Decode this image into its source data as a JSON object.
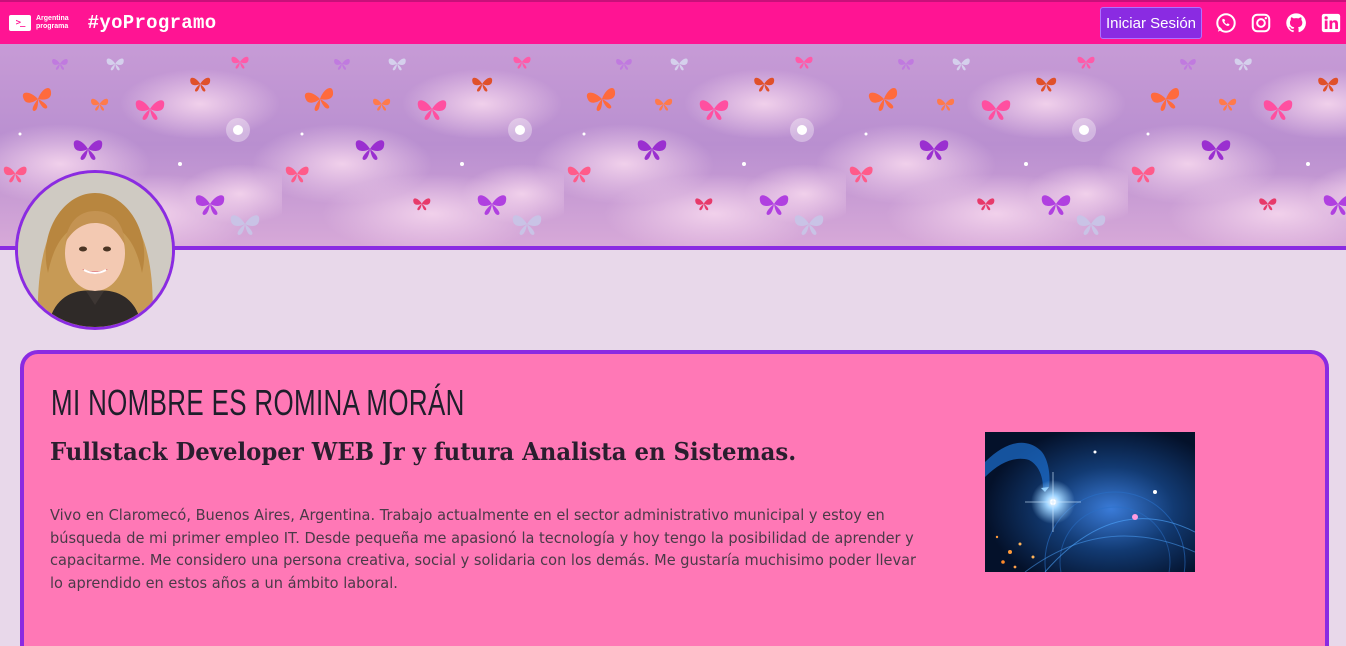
{
  "navbar": {
    "logo_mark": ">_",
    "logo_line1": "Argentina",
    "logo_line2": "programa",
    "hashtag": "#yoProgramo",
    "login_label": "Iniciar Sesión",
    "social_icons": [
      "whatsapp-icon",
      "instagram-icon",
      "github-icon",
      "linkedin-icon"
    ],
    "color": "#ff1493"
  },
  "banner": {
    "theme": "butterflies-clouds",
    "colors": [
      "#c89ad8",
      "#8a2be2"
    ]
  },
  "profile": {
    "name": "Mi nombre es Romina Morán",
    "subtitle": "Fullstack Developer WEB Jr y futura Analista en Sistemas.",
    "bio": "Vivo en Claromecó, Buenos Aires, Argentina. Trabajo actualmente en el sector administrativo municipal y estoy en búsqueda de mi primer empleo IT. Desde pequeña me apasionó la tecnología y hoy tengo la posibilidad de aprender y capacitarme. Me considero una persona creativa, social y solidaria con los demás. Me gustaría muchisimo poder llevar lo aprendido en estos años a un ámbito laboral."
  },
  "colors": {
    "accent": "#8a2be2",
    "card_bg": "#ff78b6",
    "page_bg": "#e8d8ea"
  }
}
